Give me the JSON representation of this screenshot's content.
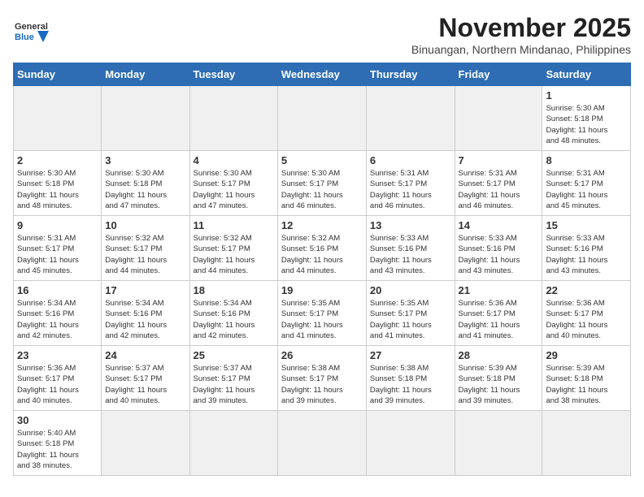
{
  "header": {
    "logo_general": "General",
    "logo_blue": "Blue",
    "title": "November 2025",
    "subtitle": "Binuangan, Northern Mindanao, Philippines"
  },
  "calendar": {
    "days_of_week": [
      "Sunday",
      "Monday",
      "Tuesday",
      "Wednesday",
      "Thursday",
      "Friday",
      "Saturday"
    ],
    "weeks": [
      [
        {
          "day": "",
          "info": ""
        },
        {
          "day": "",
          "info": ""
        },
        {
          "day": "",
          "info": ""
        },
        {
          "day": "",
          "info": ""
        },
        {
          "day": "",
          "info": ""
        },
        {
          "day": "",
          "info": ""
        },
        {
          "day": "1",
          "info": "Sunrise: 5:30 AM\nSunset: 5:18 PM\nDaylight: 11 hours\nand 48 minutes."
        }
      ],
      [
        {
          "day": "2",
          "info": "Sunrise: 5:30 AM\nSunset: 5:18 PM\nDaylight: 11 hours\nand 48 minutes."
        },
        {
          "day": "3",
          "info": "Sunrise: 5:30 AM\nSunset: 5:18 PM\nDaylight: 11 hours\nand 47 minutes."
        },
        {
          "day": "4",
          "info": "Sunrise: 5:30 AM\nSunset: 5:17 PM\nDaylight: 11 hours\nand 47 minutes."
        },
        {
          "day": "5",
          "info": "Sunrise: 5:30 AM\nSunset: 5:17 PM\nDaylight: 11 hours\nand 46 minutes."
        },
        {
          "day": "6",
          "info": "Sunrise: 5:31 AM\nSunset: 5:17 PM\nDaylight: 11 hours\nand 46 minutes."
        },
        {
          "day": "7",
          "info": "Sunrise: 5:31 AM\nSunset: 5:17 PM\nDaylight: 11 hours\nand 46 minutes."
        },
        {
          "day": "8",
          "info": "Sunrise: 5:31 AM\nSunset: 5:17 PM\nDaylight: 11 hours\nand 45 minutes."
        }
      ],
      [
        {
          "day": "9",
          "info": "Sunrise: 5:31 AM\nSunset: 5:17 PM\nDaylight: 11 hours\nand 45 minutes."
        },
        {
          "day": "10",
          "info": "Sunrise: 5:32 AM\nSunset: 5:17 PM\nDaylight: 11 hours\nand 44 minutes."
        },
        {
          "day": "11",
          "info": "Sunrise: 5:32 AM\nSunset: 5:17 PM\nDaylight: 11 hours\nand 44 minutes."
        },
        {
          "day": "12",
          "info": "Sunrise: 5:32 AM\nSunset: 5:16 PM\nDaylight: 11 hours\nand 44 minutes."
        },
        {
          "day": "13",
          "info": "Sunrise: 5:33 AM\nSunset: 5:16 PM\nDaylight: 11 hours\nand 43 minutes."
        },
        {
          "day": "14",
          "info": "Sunrise: 5:33 AM\nSunset: 5:16 PM\nDaylight: 11 hours\nand 43 minutes."
        },
        {
          "day": "15",
          "info": "Sunrise: 5:33 AM\nSunset: 5:16 PM\nDaylight: 11 hours\nand 43 minutes."
        }
      ],
      [
        {
          "day": "16",
          "info": "Sunrise: 5:34 AM\nSunset: 5:16 PM\nDaylight: 11 hours\nand 42 minutes."
        },
        {
          "day": "17",
          "info": "Sunrise: 5:34 AM\nSunset: 5:16 PM\nDaylight: 11 hours\nand 42 minutes."
        },
        {
          "day": "18",
          "info": "Sunrise: 5:34 AM\nSunset: 5:16 PM\nDaylight: 11 hours\nand 42 minutes."
        },
        {
          "day": "19",
          "info": "Sunrise: 5:35 AM\nSunset: 5:17 PM\nDaylight: 11 hours\nand 41 minutes."
        },
        {
          "day": "20",
          "info": "Sunrise: 5:35 AM\nSunset: 5:17 PM\nDaylight: 11 hours\nand 41 minutes."
        },
        {
          "day": "21",
          "info": "Sunrise: 5:36 AM\nSunset: 5:17 PM\nDaylight: 11 hours\nand 41 minutes."
        },
        {
          "day": "22",
          "info": "Sunrise: 5:36 AM\nSunset: 5:17 PM\nDaylight: 11 hours\nand 40 minutes."
        }
      ],
      [
        {
          "day": "23",
          "info": "Sunrise: 5:36 AM\nSunset: 5:17 PM\nDaylight: 11 hours\nand 40 minutes."
        },
        {
          "day": "24",
          "info": "Sunrise: 5:37 AM\nSunset: 5:17 PM\nDaylight: 11 hours\nand 40 minutes."
        },
        {
          "day": "25",
          "info": "Sunrise: 5:37 AM\nSunset: 5:17 PM\nDaylight: 11 hours\nand 39 minutes."
        },
        {
          "day": "26",
          "info": "Sunrise: 5:38 AM\nSunset: 5:17 PM\nDaylight: 11 hours\nand 39 minutes."
        },
        {
          "day": "27",
          "info": "Sunrise: 5:38 AM\nSunset: 5:18 PM\nDaylight: 11 hours\nand 39 minutes."
        },
        {
          "day": "28",
          "info": "Sunrise: 5:39 AM\nSunset: 5:18 PM\nDaylight: 11 hours\nand 39 minutes."
        },
        {
          "day": "29",
          "info": "Sunrise: 5:39 AM\nSunset: 5:18 PM\nDaylight: 11 hours\nand 38 minutes."
        }
      ],
      [
        {
          "day": "30",
          "info": "Sunrise: 5:40 AM\nSunset: 5:18 PM\nDaylight: 11 hours\nand 38 minutes."
        },
        {
          "day": "",
          "info": ""
        },
        {
          "day": "",
          "info": ""
        },
        {
          "day": "",
          "info": ""
        },
        {
          "day": "",
          "info": ""
        },
        {
          "day": "",
          "info": ""
        },
        {
          "day": "",
          "info": ""
        }
      ]
    ]
  }
}
